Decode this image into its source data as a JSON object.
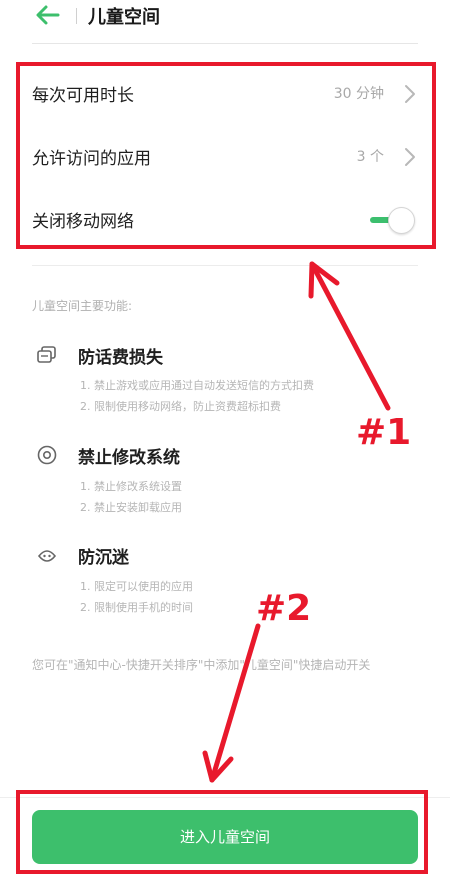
{
  "header": {
    "title": "儿童空间",
    "back_icon": "arrow-left-icon"
  },
  "settings": {
    "daily_time": {
      "label": "每次可用时长",
      "value": "30 分钟"
    },
    "allowed_apps": {
      "label": "允许访问的应用",
      "value": "3 个"
    },
    "mobile_network": {
      "label": "关闭移动网络",
      "enabled": true
    }
  },
  "features": {
    "heading": "儿童空间主要功能:",
    "items": [
      {
        "icon": "message-icon",
        "title": "防话费损失",
        "lines": [
          "1. 禁止游戏或应用通过自动发送短信的方式扣费",
          "2. 限制使用移动网络，防止资费超标扣费"
        ]
      },
      {
        "icon": "target-icon",
        "title": "禁止修改系统",
        "lines": [
          "1. 禁止修改系统设置",
          "2. 禁止安装卸载应用"
        ]
      },
      {
        "icon": "face-icon",
        "title": "防沉迷",
        "lines": [
          "1. 限定可以使用的应用",
          "2. 限制使用手机的时间"
        ]
      }
    ]
  },
  "note": "您可在\"通知中心-快捷开关排序\"中添加\"儿童空间\"快捷启动开关",
  "enter_button": {
    "label": "进入儿童空间"
  },
  "annotations": {
    "label_1": "#1",
    "label_2": "#2",
    "color": "#e8192c"
  },
  "colors": {
    "accent": "#3dbf6c",
    "annotation": "#e8192c"
  }
}
